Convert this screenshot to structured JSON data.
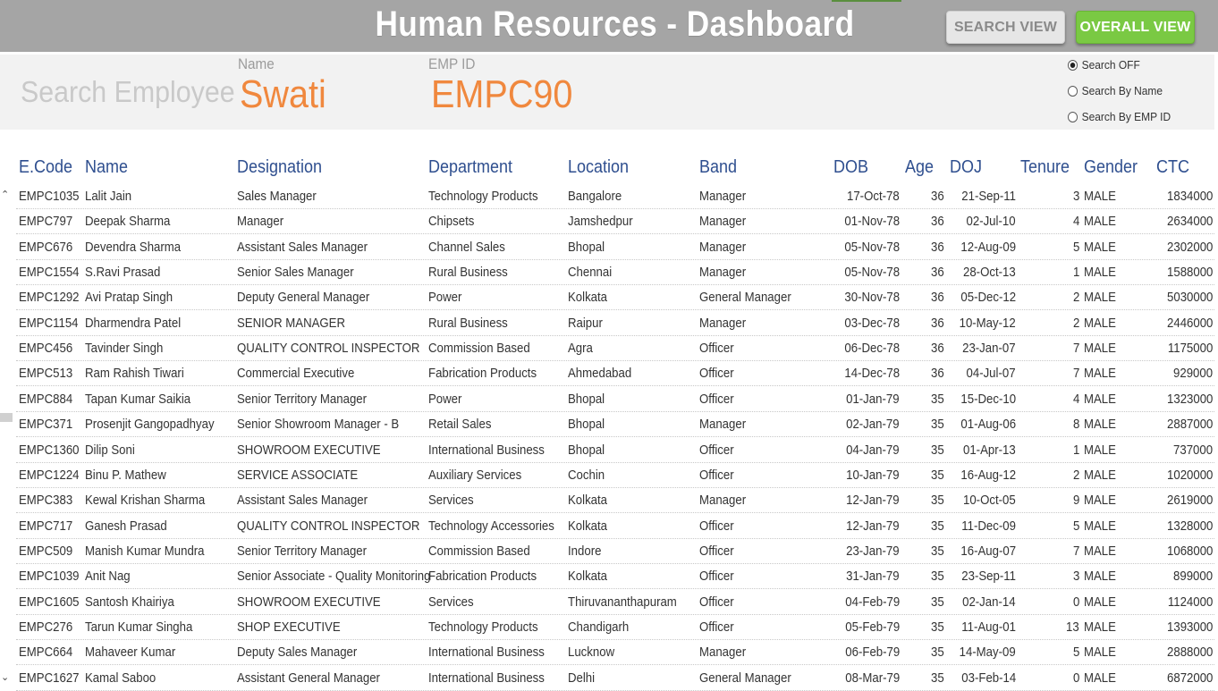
{
  "header": {
    "title": "Human Resources - Dashboard",
    "search_view_label": "SEARCH VIEW",
    "overall_view_label": "OVERALL VIEW"
  },
  "search": {
    "label": "Search Employee",
    "name_caption": "Name",
    "name_value": "Swati",
    "empid_caption": "EMP ID",
    "empid_value": "EMPC90",
    "options": [
      {
        "label": "Search OFF",
        "selected": true
      },
      {
        "label": "Search By Name",
        "selected": false
      },
      {
        "label": "Search By EMP ID",
        "selected": false
      }
    ]
  },
  "table": {
    "columns": [
      "E.Code",
      "Name",
      "Designation",
      "Department",
      "Location",
      "Band",
      "DOB",
      "Age",
      "DOJ",
      "Tenure",
      "Gender",
      "CTC"
    ],
    "rows": [
      [
        "EMPC1035",
        "Lalit Jain",
        "Sales Manager",
        "Technology Products",
        "Bangalore",
        "Manager",
        "17-Oct-78",
        "36",
        "21-Sep-11",
        "3",
        "MALE",
        "1834000"
      ],
      [
        "EMPC797",
        "Deepak Sharma",
        "Manager",
        "Chipsets",
        "Jamshedpur",
        "Manager",
        "01-Nov-78",
        "36",
        "02-Jul-10",
        "4",
        "MALE",
        "2634000"
      ],
      [
        "EMPC676",
        "Devendra Sharma",
        "Assistant Sales Manager",
        "Channel Sales",
        "Bhopal",
        "Manager",
        "05-Nov-78",
        "36",
        "12-Aug-09",
        "5",
        "MALE",
        "2302000"
      ],
      [
        "EMPC1554",
        "S.Ravi Prasad",
        "Senior Sales Manager",
        "Rural Business",
        "Chennai",
        "Manager",
        "05-Nov-78",
        "36",
        "28-Oct-13",
        "1",
        "MALE",
        "1588000"
      ],
      [
        "EMPC1292",
        "Avi Pratap Singh",
        "Deputy General Manager",
        "Power",
        "Kolkata",
        "General Manager",
        "30-Nov-78",
        "36",
        "05-Dec-12",
        "2",
        "MALE",
        "5030000"
      ],
      [
        "EMPC1154",
        "Dharmendra Patel",
        "SENIOR MANAGER",
        "Rural Business",
        "Raipur",
        "Manager",
        "03-Dec-78",
        "36",
        "10-May-12",
        "2",
        "MALE",
        "2446000"
      ],
      [
        "EMPC456",
        "Tavinder Singh",
        "QUALITY CONTROL INSPECTOR",
        "Commission Based",
        "Agra",
        "Officer",
        "06-Dec-78",
        "36",
        "23-Jan-07",
        "7",
        "MALE",
        "1175000"
      ],
      [
        "EMPC513",
        "Ram Rahish Tiwari",
        "Commercial Executive",
        "Fabrication Products",
        "Ahmedabad",
        "Officer",
        "14-Dec-78",
        "36",
        "04-Jul-07",
        "7",
        "MALE",
        "929000"
      ],
      [
        "EMPC884",
        "Tapan Kumar Saikia",
        "Senior Territory Manager",
        "Power",
        "Bhopal",
        "Officer",
        "01-Jan-79",
        "35",
        "15-Dec-10",
        "4",
        "MALE",
        "1323000"
      ],
      [
        "EMPC371",
        "Prosenjit Gangopadhyay",
        "Senior Showroom Manager - B",
        "Retail Sales",
        "Bhopal",
        "Manager",
        "02-Jan-79",
        "35",
        "01-Aug-06",
        "8",
        "MALE",
        "2887000"
      ],
      [
        "EMPC1360",
        "Dilip Soni",
        "SHOWROOM EXECUTIVE",
        "International Business",
        "Bhopal",
        "Officer",
        "04-Jan-79",
        "35",
        "01-Apr-13",
        "1",
        "MALE",
        "737000"
      ],
      [
        "EMPC1224",
        "Binu P. Mathew",
        "SERVICE ASSOCIATE",
        "Auxiliary Services",
        "Cochin",
        "Officer",
        "10-Jan-79",
        "35",
        "16-Aug-12",
        "2",
        "MALE",
        "1020000"
      ],
      [
        "EMPC383",
        "Kewal Krishan Sharma",
        "Assistant Sales Manager",
        "Services",
        "Kolkata",
        "Manager",
        "12-Jan-79",
        "35",
        "10-Oct-05",
        "9",
        "MALE",
        "2619000"
      ],
      [
        "EMPC717",
        "Ganesh Prasad",
        "QUALITY CONTROL INSPECTOR",
        "Technology Accessories",
        "Kolkata",
        "Officer",
        "12-Jan-79",
        "35",
        "11-Dec-09",
        "5",
        "MALE",
        "1328000"
      ],
      [
        "EMPC509",
        "Manish Kumar Mundra",
        "Senior Territory Manager",
        "Commission Based",
        "Indore",
        "Officer",
        "23-Jan-79",
        "35",
        "16-Aug-07",
        "7",
        "MALE",
        "1068000"
      ],
      [
        "EMPC1039",
        "Anit Nag",
        "Senior Associate - Quality Monitoring",
        "Fabrication Products",
        "Kolkata",
        "Officer",
        "31-Jan-79",
        "35",
        "23-Sep-11",
        "3",
        "MALE",
        "899000"
      ],
      [
        "EMPC1605",
        "Santosh Khairiya",
        "SHOWROOM EXECUTIVE",
        "Services",
        "Thiruvananthapuram",
        "Officer",
        "04-Feb-79",
        "35",
        "02-Jan-14",
        "0",
        "MALE",
        "1124000"
      ],
      [
        "EMPC276",
        "Tarun Kumar Singha",
        "SHOP EXECUTIVE",
        "Technology Products",
        "Chandigarh",
        "Officer",
        "05-Feb-79",
        "35",
        "11-Aug-01",
        "13",
        "MALE",
        "1393000"
      ],
      [
        "EMPC664",
        "Mahaveer Kumar",
        "Deputy Sales Manager",
        "International Business",
        "Lucknow",
        "Manager",
        "06-Feb-79",
        "35",
        "14-May-09",
        "5",
        "MALE",
        "2888000"
      ],
      [
        "EMPC1627",
        "Kamal Saboo",
        "Assistant General Manager",
        "International Business",
        "Delhi",
        "General Manager",
        "08-Mar-79",
        "35",
        "03-Feb-14",
        "0",
        "MALE",
        "6872000"
      ]
    ]
  },
  "colors": {
    "header_bg": "#a5a5a5",
    "accent_orange": "#f0883e",
    "header_text_blue": "#2f4f8f",
    "overall_btn_green": "#7ac943"
  }
}
